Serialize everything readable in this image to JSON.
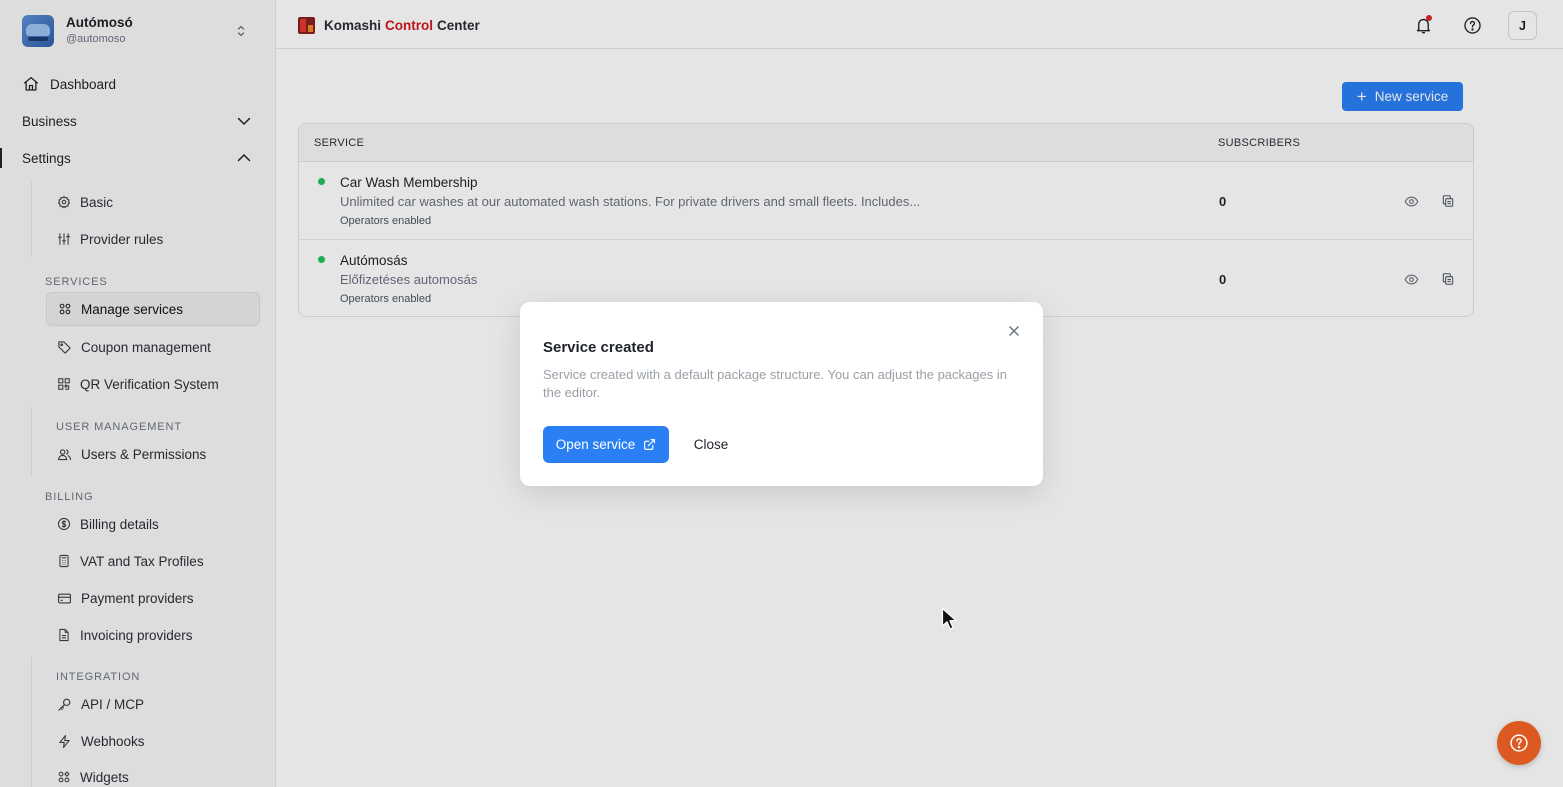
{
  "org": {
    "name": "Autómosó",
    "handle": "@automoso"
  },
  "nav": {
    "dashboard": "Dashboard",
    "business": "Business",
    "settings": "Settings",
    "basic": "Basic",
    "provider_rules": "Provider rules",
    "services_label": "SERVICES",
    "manage_services": "Manage services",
    "coupon_management": "Coupon management",
    "qr_verification": "QR Verification System",
    "user_management_label": "USER MANAGEMENT",
    "users_permissions": "Users & Permissions",
    "billing_label": "BILLING",
    "billing_details": "Billing details",
    "vat_tax": "VAT and Tax Profiles",
    "payment_providers": "Payment providers",
    "invoicing_providers": "Invoicing providers",
    "integration_label": "INTEGRATION",
    "api_mcp": "API / MCP",
    "webhooks": "Webhooks",
    "widgets": "Widgets"
  },
  "header": {
    "brand_part1": "Komashi",
    "brand_part2": "Control",
    "brand_part3": "Center",
    "user_initial": "J"
  },
  "main": {
    "new_service_label": "New service",
    "columns": {
      "service": "SERVICE",
      "subscribers": "SUBSCRIBERS"
    },
    "services": [
      {
        "name": "Car Wash Membership",
        "description": "Unlimited car washes at our automated wash stations. For private drivers and small fleets. Includes...",
        "operators": "Operators enabled",
        "subscribers": "0",
        "status_color": "#1ec35b"
      },
      {
        "name": "Autómosás",
        "description": "Előfizetéses automosás",
        "operators": "Operators enabled",
        "subscribers": "0",
        "status_color": "#1ec35b"
      }
    ]
  },
  "modal": {
    "title": "Service created",
    "body": "Service created with a default package structure. You can adjust the packages in the editor.",
    "open_label": "Open service",
    "close_label": "Close"
  },
  "colors": {
    "accent": "#2b7ff5",
    "fab": "#dc5a22",
    "brand_red": "#d0191c",
    "status_active": "#1ec35b"
  },
  "icons": [
    "home-icon",
    "chevron-down-icon",
    "chevron-up-icon",
    "gear-icon",
    "sliders-icon",
    "grid-icon",
    "tag-icon",
    "qr-icon",
    "users-icon",
    "dollar-circle-icon",
    "calculator-icon",
    "credit-card-icon",
    "document-icon",
    "key-icon",
    "zap-icon",
    "widgets-icon",
    "bell-icon",
    "help-circle-icon",
    "eye-icon",
    "copy-icon",
    "close-icon",
    "external-link-icon"
  ]
}
